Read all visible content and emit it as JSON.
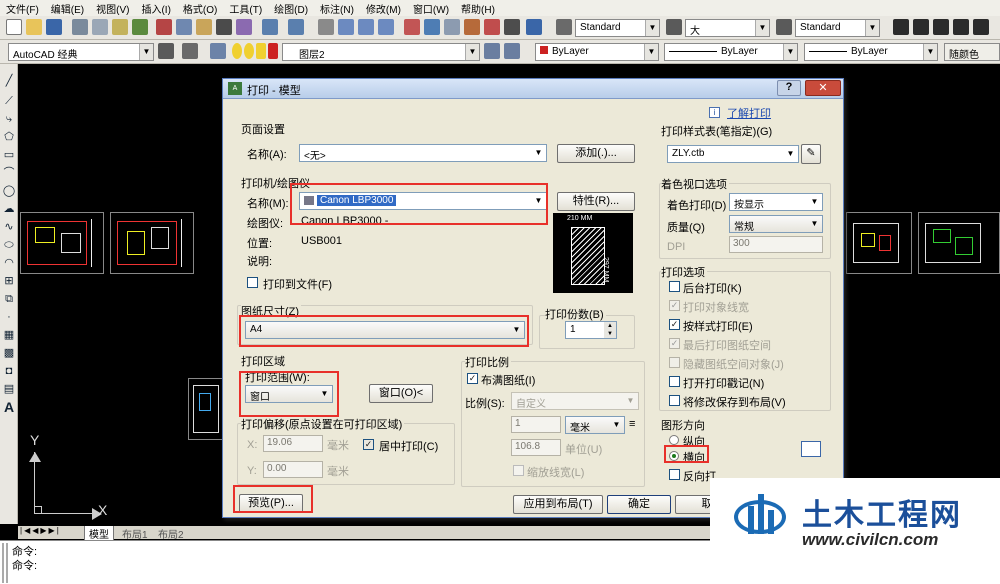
{
  "menu": [
    "文件(F)",
    "编辑(E)",
    "视图(V)",
    "插入(I)",
    "格式(O)",
    "工具(T)",
    "绘图(D)",
    "标注(N)",
    "修改(M)",
    "窗口(W)",
    "帮助(H)"
  ],
  "toolbar": {
    "text_style": "Standard",
    "dim_style": "大",
    "table_style": "Standard",
    "workspace": "AutoCAD 经典",
    "layer": "图层2",
    "color": "ByLayer",
    "linetype": "ByLayer",
    "lineweight": "ByLayer",
    "plotstyle": "随颜色"
  },
  "dialog": {
    "title": "打印 - 模型",
    "help_link": "了解打印",
    "page_setup": {
      "title": "页面设置",
      "name_label": "名称(A):",
      "name_value": "<无>",
      "add_button": "添加(.)..."
    },
    "printer": {
      "title": "打印机/绘图仪",
      "name_label": "名称(M):",
      "name_value": "Canon LBP3000",
      "properties_button": "特性(R)...",
      "plotter_label": "绘图仪:",
      "plotter_value": "Canon LBP3000 -",
      "location_label": "位置:",
      "location_value": "USB001",
      "description_label": "说明:",
      "print_to_file": "打印到文件(F)",
      "preview_width": "210 MM",
      "preview_height": "297 MM"
    },
    "paper_size": {
      "title": "图纸尺寸(Z)",
      "value": "A4"
    },
    "copies": {
      "title": "打印份数(B)",
      "value": "1"
    },
    "plot_area": {
      "title": "打印区域",
      "range_label": "打印范围(W):",
      "range_value": "窗口",
      "window_button": "窗口(O)<"
    },
    "plot_scale": {
      "title": "打印比例",
      "fit_paper": "布满图纸(I)",
      "scale_label": "比例(S):",
      "scale_value": "自定义",
      "value1": "1",
      "unit": "毫米",
      "value2": "106.8",
      "unit_label": "单位(U)",
      "scale_lineweights": "缩放线宽(L)"
    },
    "plot_offset": {
      "title": "打印偏移(原点设置在可打印区域)",
      "x_label": "X:",
      "x_value": "19.06",
      "y_label": "Y:",
      "y_value": "0.00",
      "unit": "毫米",
      "center": "居中打印(C)"
    },
    "plot_style_table": {
      "title": "打印样式表(笔指定)(G)",
      "value": "ZLY.ctb"
    },
    "shaded_viewport": {
      "title": "着色视口选项",
      "shade_label": "着色打印(D)",
      "shade_value": "按显示",
      "quality_label": "质量(Q)",
      "quality_value": "常规",
      "dpi_label": "DPI",
      "dpi_value": "300"
    },
    "plot_options": {
      "title": "打印选项",
      "items": [
        {
          "label": "后台打印(K)",
          "checked": false,
          "enabled": true
        },
        {
          "label": "打印对象线宽",
          "checked": true,
          "enabled": false
        },
        {
          "label": "按样式打印(E)",
          "checked": true,
          "enabled": true
        },
        {
          "label": "最后打印图纸空间",
          "checked": true,
          "enabled": false
        },
        {
          "label": "隐藏图纸空间对象(J)",
          "checked": false,
          "enabled": false
        },
        {
          "label": "打开打印戳记(N)",
          "checked": false,
          "enabled": true
        },
        {
          "label": "将修改保存到布局(V)",
          "checked": false,
          "enabled": true
        }
      ]
    },
    "orientation": {
      "title": "图形方向",
      "portrait": "纵向",
      "landscape": "横向",
      "reverse": "反向打"
    },
    "buttons": {
      "preview": "预览(P)...",
      "apply_layout": "应用到布局(T)",
      "ok": "确定",
      "cancel": "取"
    }
  },
  "tabs": [
    "模型",
    "布局1",
    "布局2"
  ],
  "command_lines": [
    "命令:",
    "命令:"
  ],
  "ucs": {
    "x": "X",
    "y": "Y"
  },
  "watermark": {
    "title": "土木工程网",
    "url": "www.civilcn.com"
  }
}
